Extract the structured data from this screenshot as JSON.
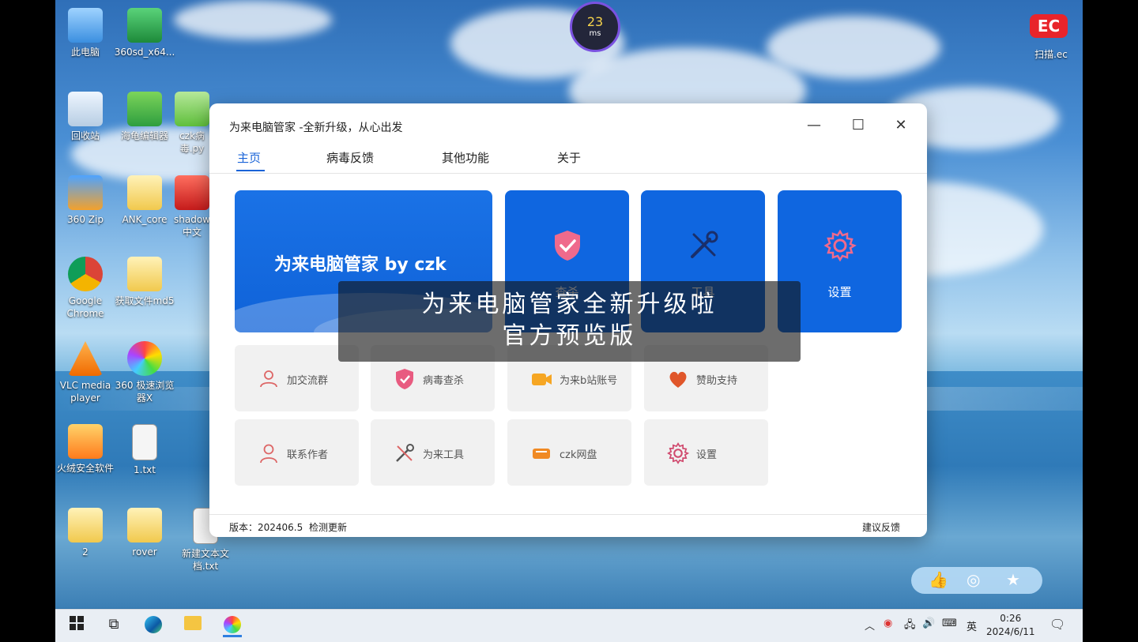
{
  "desktop_icons": [
    {
      "label": "此电脑"
    },
    {
      "label": "360sd_x64..."
    },
    {
      "label": "回收站"
    },
    {
      "label": "海龟编辑器"
    },
    {
      "label": "czk病毒.py"
    },
    {
      "label": "360 Zip"
    },
    {
      "label": "ANK_core"
    },
    {
      "label": "shadow中文"
    },
    {
      "label": "Google Chrome"
    },
    {
      "label": "获取文件md5"
    },
    {
      "label": "VLC media player"
    },
    {
      "label": "360 极速浏览器X"
    },
    {
      "label": "火绒安全软件"
    },
    {
      "label": "1.txt"
    },
    {
      "label": "2"
    },
    {
      "label": "rover"
    },
    {
      "label": "新建文本文档.txt"
    },
    {
      "label": "扫描.ec"
    }
  ],
  "latency": {
    "value": "23",
    "unit": "ms"
  },
  "window": {
    "title": "为来电脑管家 -全新升级，从心出发",
    "tabs": [
      "主页",
      "病毒反馈",
      "其他功能",
      "关于"
    ],
    "hero_text": "为来电脑管家 by czk",
    "big_tiles": [
      {
        "label": "查杀",
        "icon": "shield-check-icon"
      },
      {
        "label": "工具",
        "icon": "tools-icon"
      },
      {
        "label": "设置",
        "icon": "gear-icon"
      }
    ],
    "small_tiles": [
      {
        "label": "加交流群",
        "icon": "group-icon"
      },
      {
        "label": "病毒查杀",
        "icon": "shield-check-icon"
      },
      {
        "label": "为来b站账号",
        "icon": "video-icon"
      },
      {
        "label": "赞助支持",
        "icon": "heart-icon"
      },
      {
        "label": "联系作者",
        "icon": "user-icon"
      },
      {
        "label": "为来工具",
        "icon": "tools-icon"
      },
      {
        "label": "czk网盘",
        "icon": "drive-icon"
      },
      {
        "label": "设置",
        "icon": "gear-icon"
      }
    ],
    "footer": {
      "version": "版本：202406.5",
      "check_update": "检测更新",
      "feedback": "建议反馈"
    }
  },
  "overlay_caption": {
    "line1": "为来电脑管家全新升级啦",
    "line2": "官方预览版"
  },
  "floating_bar": {
    "icons": [
      "thumbs-up-icon",
      "coin-icon",
      "star-icon"
    ]
  },
  "taskbar": {
    "ime": "英",
    "time": "0:26",
    "date": "2024/6/11"
  },
  "colors": {
    "accent": "#0f66e0",
    "tab_active": "#1a64d8"
  }
}
